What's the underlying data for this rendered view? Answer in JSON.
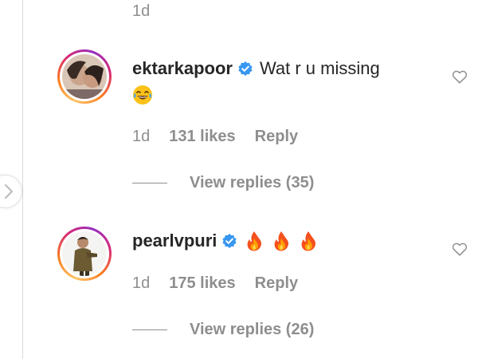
{
  "top_timestamp": "1d",
  "comments": [
    {
      "username": "ektarkapoor",
      "text": "Wat r u missing",
      "emoji": "laughing-tears-emoji",
      "time": "1d",
      "likes": "131 likes",
      "reply": "Reply",
      "view_replies": "View replies (35)"
    },
    {
      "username": "pearlvpuri",
      "text": "",
      "emoji": "fire-emoji",
      "time": "1d",
      "likes": "175 likes",
      "reply": "Reply",
      "view_replies": "View replies (26)"
    }
  ],
  "colors": {
    "verified": "#3897f0",
    "muted": "#8e8e8e",
    "text": "#262626"
  },
  "icons": [
    "chevron-right-icon",
    "verified-badge-icon",
    "heart-icon"
  ]
}
